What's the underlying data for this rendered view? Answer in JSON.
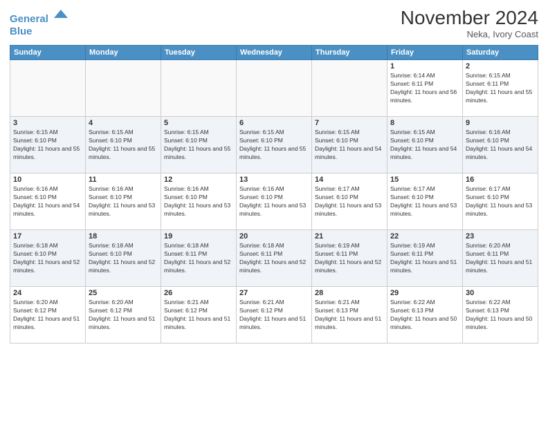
{
  "header": {
    "logo_line1": "General",
    "logo_line2": "Blue",
    "month_title": "November 2024",
    "location": "Neka, Ivory Coast"
  },
  "days_of_week": [
    "Sunday",
    "Monday",
    "Tuesday",
    "Wednesday",
    "Thursday",
    "Friday",
    "Saturday"
  ],
  "weeks": [
    [
      {
        "day": "",
        "sunrise": "",
        "sunset": "",
        "daylight": ""
      },
      {
        "day": "",
        "sunrise": "",
        "sunset": "",
        "daylight": ""
      },
      {
        "day": "",
        "sunrise": "",
        "sunset": "",
        "daylight": ""
      },
      {
        "day": "",
        "sunrise": "",
        "sunset": "",
        "daylight": ""
      },
      {
        "day": "",
        "sunrise": "",
        "sunset": "",
        "daylight": ""
      },
      {
        "day": "1",
        "sunrise": "Sunrise: 6:14 AM",
        "sunset": "Sunset: 6:11 PM",
        "daylight": "Daylight: 11 hours and 56 minutes."
      },
      {
        "day": "2",
        "sunrise": "Sunrise: 6:15 AM",
        "sunset": "Sunset: 6:11 PM",
        "daylight": "Daylight: 11 hours and 55 minutes."
      }
    ],
    [
      {
        "day": "3",
        "sunrise": "Sunrise: 6:15 AM",
        "sunset": "Sunset: 6:10 PM",
        "daylight": "Daylight: 11 hours and 55 minutes."
      },
      {
        "day": "4",
        "sunrise": "Sunrise: 6:15 AM",
        "sunset": "Sunset: 6:10 PM",
        "daylight": "Daylight: 11 hours and 55 minutes."
      },
      {
        "day": "5",
        "sunrise": "Sunrise: 6:15 AM",
        "sunset": "Sunset: 6:10 PM",
        "daylight": "Daylight: 11 hours and 55 minutes."
      },
      {
        "day": "6",
        "sunrise": "Sunrise: 6:15 AM",
        "sunset": "Sunset: 6:10 PM",
        "daylight": "Daylight: 11 hours and 55 minutes."
      },
      {
        "day": "7",
        "sunrise": "Sunrise: 6:15 AM",
        "sunset": "Sunset: 6:10 PM",
        "daylight": "Daylight: 11 hours and 54 minutes."
      },
      {
        "day": "8",
        "sunrise": "Sunrise: 6:15 AM",
        "sunset": "Sunset: 6:10 PM",
        "daylight": "Daylight: 11 hours and 54 minutes."
      },
      {
        "day": "9",
        "sunrise": "Sunrise: 6:16 AM",
        "sunset": "Sunset: 6:10 PM",
        "daylight": "Daylight: 11 hours and 54 minutes."
      }
    ],
    [
      {
        "day": "10",
        "sunrise": "Sunrise: 6:16 AM",
        "sunset": "Sunset: 6:10 PM",
        "daylight": "Daylight: 11 hours and 54 minutes."
      },
      {
        "day": "11",
        "sunrise": "Sunrise: 6:16 AM",
        "sunset": "Sunset: 6:10 PM",
        "daylight": "Daylight: 11 hours and 53 minutes."
      },
      {
        "day": "12",
        "sunrise": "Sunrise: 6:16 AM",
        "sunset": "Sunset: 6:10 PM",
        "daylight": "Daylight: 11 hours and 53 minutes."
      },
      {
        "day": "13",
        "sunrise": "Sunrise: 6:16 AM",
        "sunset": "Sunset: 6:10 PM",
        "daylight": "Daylight: 11 hours and 53 minutes."
      },
      {
        "day": "14",
        "sunrise": "Sunrise: 6:17 AM",
        "sunset": "Sunset: 6:10 PM",
        "daylight": "Daylight: 11 hours and 53 minutes."
      },
      {
        "day": "15",
        "sunrise": "Sunrise: 6:17 AM",
        "sunset": "Sunset: 6:10 PM",
        "daylight": "Daylight: 11 hours and 53 minutes."
      },
      {
        "day": "16",
        "sunrise": "Sunrise: 6:17 AM",
        "sunset": "Sunset: 6:10 PM",
        "daylight": "Daylight: 11 hours and 53 minutes."
      }
    ],
    [
      {
        "day": "17",
        "sunrise": "Sunrise: 6:18 AM",
        "sunset": "Sunset: 6:10 PM",
        "daylight": "Daylight: 11 hours and 52 minutes."
      },
      {
        "day": "18",
        "sunrise": "Sunrise: 6:18 AM",
        "sunset": "Sunset: 6:10 PM",
        "daylight": "Daylight: 11 hours and 52 minutes."
      },
      {
        "day": "19",
        "sunrise": "Sunrise: 6:18 AM",
        "sunset": "Sunset: 6:11 PM",
        "daylight": "Daylight: 11 hours and 52 minutes."
      },
      {
        "day": "20",
        "sunrise": "Sunrise: 6:18 AM",
        "sunset": "Sunset: 6:11 PM",
        "daylight": "Daylight: 11 hours and 52 minutes."
      },
      {
        "day": "21",
        "sunrise": "Sunrise: 6:19 AM",
        "sunset": "Sunset: 6:11 PM",
        "daylight": "Daylight: 11 hours and 52 minutes."
      },
      {
        "day": "22",
        "sunrise": "Sunrise: 6:19 AM",
        "sunset": "Sunset: 6:11 PM",
        "daylight": "Daylight: 11 hours and 51 minutes."
      },
      {
        "day": "23",
        "sunrise": "Sunrise: 6:20 AM",
        "sunset": "Sunset: 6:11 PM",
        "daylight": "Daylight: 11 hours and 51 minutes."
      }
    ],
    [
      {
        "day": "24",
        "sunrise": "Sunrise: 6:20 AM",
        "sunset": "Sunset: 6:12 PM",
        "daylight": "Daylight: 11 hours and 51 minutes."
      },
      {
        "day": "25",
        "sunrise": "Sunrise: 6:20 AM",
        "sunset": "Sunset: 6:12 PM",
        "daylight": "Daylight: 11 hours and 51 minutes."
      },
      {
        "day": "26",
        "sunrise": "Sunrise: 6:21 AM",
        "sunset": "Sunset: 6:12 PM",
        "daylight": "Daylight: 11 hours and 51 minutes."
      },
      {
        "day": "27",
        "sunrise": "Sunrise: 6:21 AM",
        "sunset": "Sunset: 6:12 PM",
        "daylight": "Daylight: 11 hours and 51 minutes."
      },
      {
        "day": "28",
        "sunrise": "Sunrise: 6:21 AM",
        "sunset": "Sunset: 6:13 PM",
        "daylight": "Daylight: 11 hours and 51 minutes."
      },
      {
        "day": "29",
        "sunrise": "Sunrise: 6:22 AM",
        "sunset": "Sunset: 6:13 PM",
        "daylight": "Daylight: 11 hours and 50 minutes."
      },
      {
        "day": "30",
        "sunrise": "Sunrise: 6:22 AM",
        "sunset": "Sunset: 6:13 PM",
        "daylight": "Daylight: 11 hours and 50 minutes."
      }
    ]
  ]
}
